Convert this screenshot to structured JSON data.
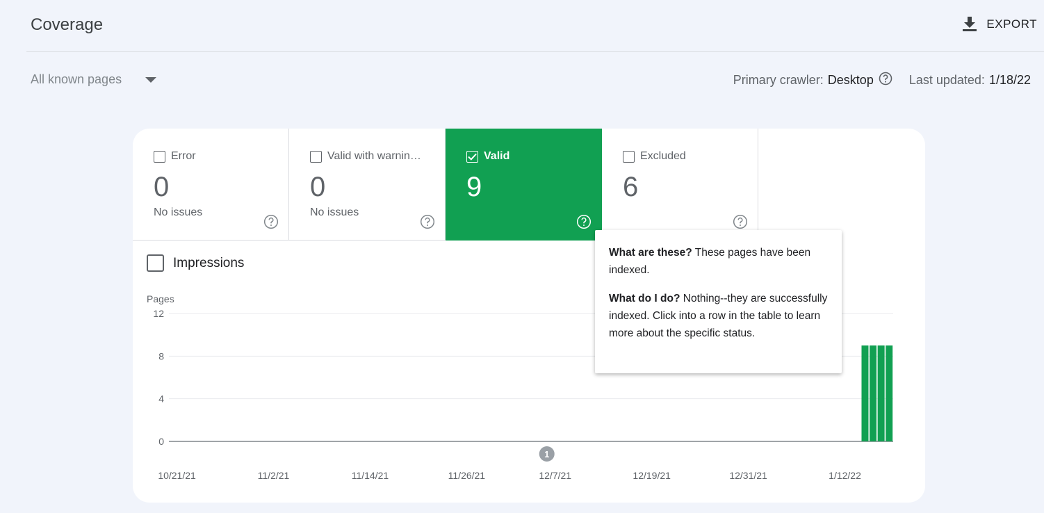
{
  "header": {
    "title": "Coverage",
    "export_label": "EXPORT"
  },
  "filter": {
    "selected": "All known pages"
  },
  "meta": {
    "crawler_label": "Primary crawler:",
    "crawler_value": "Desktop",
    "updated_label": "Last updated:",
    "updated_value": "1/18/22"
  },
  "tiles": [
    {
      "label": "Error",
      "count": "0",
      "sub": "No issues",
      "checked": false
    },
    {
      "label": "Valid with warnin…",
      "count": "0",
      "sub": "No issues",
      "checked": false
    },
    {
      "label": "Valid",
      "count": "9",
      "sub": "",
      "checked": true
    },
    {
      "label": "Excluded",
      "count": "6",
      "sub": "",
      "checked": false
    }
  ],
  "impressions_label": "Impressions",
  "tooltip": {
    "q1": "What are these?",
    "a1": " These pages have been indexed.",
    "q2": "What do I do?",
    "a2": " Nothing--they are successfully indexed. Click into a row in the table to learn more about the specific status."
  },
  "colors": {
    "valid_green": "#11a052",
    "background": "#f1f4fb"
  },
  "chart_data": {
    "type": "bar",
    "ylabel": "Pages",
    "ylim": [
      0,
      12
    ],
    "yticks": [
      0,
      4,
      8,
      12
    ],
    "xtick_labels": [
      "10/21/21",
      "11/2/21",
      "11/14/21",
      "11/26/21",
      "12/7/21",
      "12/19/21",
      "12/31/21",
      "1/12/22"
    ],
    "x_start": "10/20/21",
    "x_end": "1/18/22",
    "annotation": {
      "label": "1",
      "date": "12/7/21"
    },
    "series": [
      {
        "color": "#11a052",
        "dates": [
          "1/15/22",
          "1/16/22",
          "1/17/22",
          "1/18/22"
        ],
        "values": [
          9,
          9,
          9,
          9
        ]
      }
    ],
    "grid": true
  }
}
